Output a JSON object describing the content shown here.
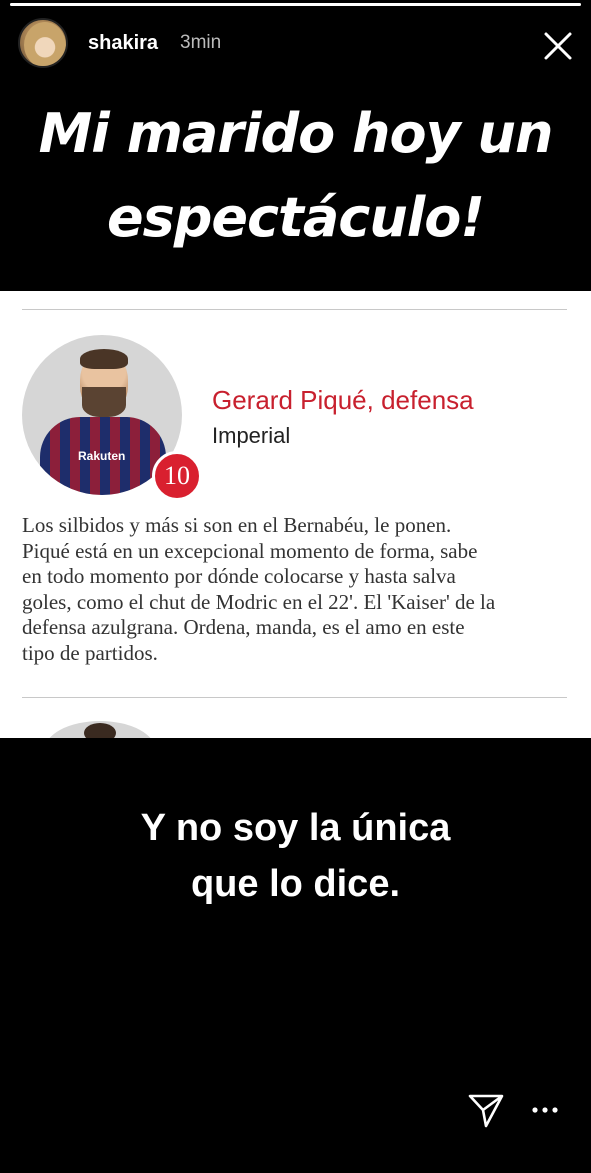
{
  "story": {
    "progress": 1.0,
    "username": "shakira",
    "timestamp": "3min",
    "headline_line1": "Mi marido hoy un",
    "headline_line2": "espectáculo!",
    "caption_line1": "Y no soy la única",
    "caption_line2": "que lo dice."
  },
  "article": {
    "player_name": "Gerard Piqué, defensa",
    "rating_label": "Imperial",
    "score": "10",
    "shirt_sponsor": "Rakuten",
    "body_lines": [
      "Los silbidos y más si son en el Bernabéu, le ponen.",
      "Piqué está en un excepcional momento de forma, sabe",
      "en todo momento por dónde colocarse y hasta salva",
      "goles, como el chut de Modric en el 22'. El 'Kaiser' de la",
      "defensa azulgrana. Ordena, manda, es el amo en este",
      "tipo de partidos."
    ]
  },
  "icons": {
    "close": "close-icon",
    "share": "send-icon",
    "more": "more-icon"
  },
  "colors": {
    "accent_red": "#d9202f",
    "name_red": "#c8202e"
  }
}
